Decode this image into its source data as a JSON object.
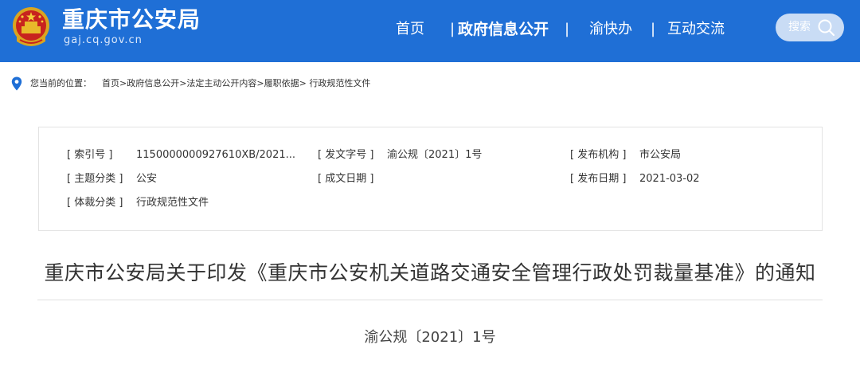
{
  "header": {
    "site_title": "重庆市公安局",
    "site_domain": "gaj.cq.gov.cn",
    "brand_color": "#1f6fd6",
    "nav": {
      "home": "首页",
      "info_open": "政府信息公开",
      "yu_kuai_ban": "渝快办",
      "interaction": "互动交流",
      "separator": "|"
    },
    "search_label": "搜索"
  },
  "breadcrumb": {
    "label": "您当前的位置：",
    "path": "首页>政府信息公开>法定主动公开内容>履职依据> 行政规范性文件"
  },
  "meta": {
    "index_no": {
      "key": "[ 索引号 ]",
      "value": "1150000000927610XB/2021..."
    },
    "doc_no": {
      "key": "[ 发文字号 ]",
      "value": "渝公规〔2021〕1号"
    },
    "issuer": {
      "key": "[ 发布机构 ]",
      "value": "市公安局"
    },
    "topic": {
      "key": "[ 主题分类 ]",
      "value": "公安"
    },
    "written_date": {
      "key": "[ 成文日期 ]",
      "value": ""
    },
    "publish_date": {
      "key": "[ 发布日期 ]",
      "value": "2021-03-02"
    },
    "genre": {
      "key": "[ 体裁分类 ]",
      "value": "行政规范性文件"
    }
  },
  "document": {
    "title": "重庆市公安局关于印发《重庆市公安机关道路交通安全管理行政处罚裁量基准》的通知",
    "number": "渝公规〔2021〕1号"
  }
}
